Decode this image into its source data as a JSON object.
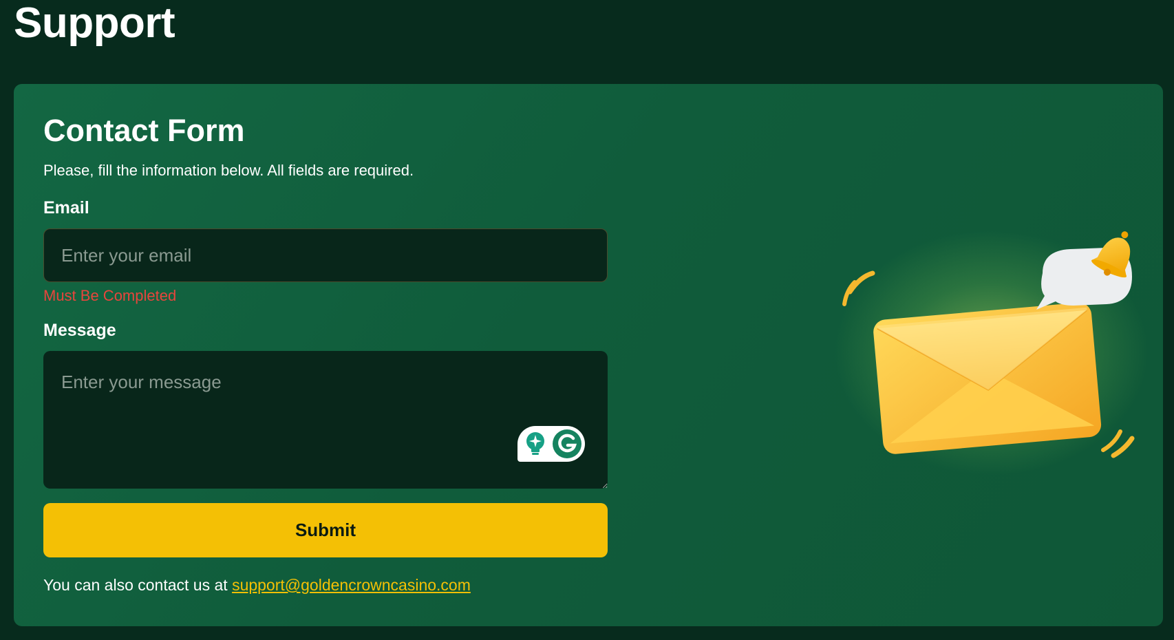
{
  "page": {
    "title": "Support"
  },
  "form": {
    "title": "Contact Form",
    "intro": "Please, fill the information below. All fields are required.",
    "email": {
      "label": "Email",
      "placeholder": "Enter your email",
      "value": "",
      "error": "Must Be Completed"
    },
    "message": {
      "label": "Message",
      "placeholder": "Enter your message",
      "value": ""
    },
    "submit_label": "Submit",
    "contact_prefix": "You can also contact us at",
    "contact_email": "support@goldencrowncasino.com"
  },
  "icons": {
    "grammarly_assist": "lightbulb-sparkle-icon",
    "grammarly": "grammarly-g-icon",
    "illustration": "envelope-bell-notification"
  },
  "colors": {
    "background": "#072b1d",
    "card": "#116140",
    "input": "#08261a",
    "accent": "#f4c005",
    "error": "#e8453c",
    "link": "#f4c005"
  }
}
